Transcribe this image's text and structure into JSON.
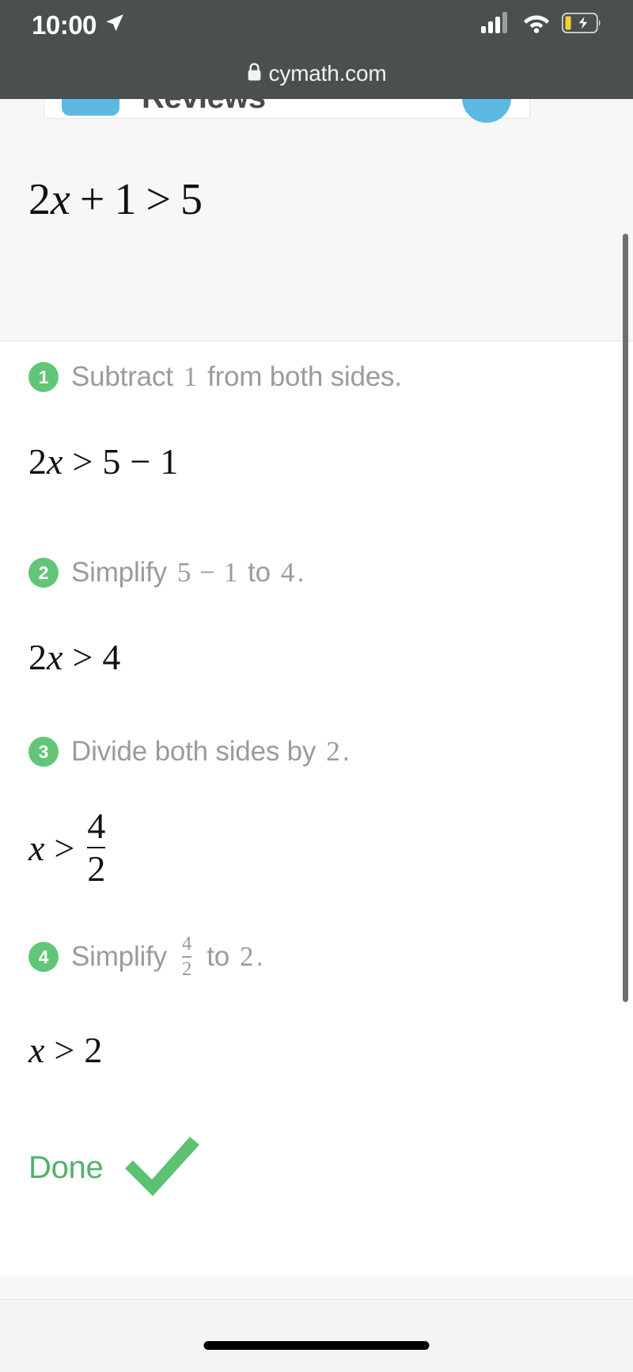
{
  "status_bar": {
    "time": "10:00",
    "location_icon": "location-arrow-icon",
    "cellular_icon": "cellular-signal-icon",
    "wifi_icon": "wifi-icon",
    "battery_icon": "battery-charging-icon",
    "background_color": "#4a4f4f"
  },
  "browser": {
    "lock_icon": "lock-icon",
    "url": "cymath.com"
  },
  "reviews_banner": {
    "title": "Reviews",
    "icon": "reviews-icon",
    "avatar": "avatar-circle",
    "accent_color": "#5bb9e2"
  },
  "problem": {
    "lhs_coefficient": "2",
    "variable": "x",
    "plus": "+",
    "constant": "1",
    "relation": ">",
    "rhs": "5",
    "full": "2x + 1 > 5"
  },
  "steps": [
    {
      "number": "1",
      "verb": "Subtract",
      "operand": "1",
      "tail": "from both sides.",
      "result_left_coeff": "2",
      "result_variable": "x",
      "result_relation": ">",
      "result_a": "5",
      "result_op": "−",
      "result_b": "1",
      "result_full": "2x > 5 − 1"
    },
    {
      "number": "2",
      "verb": "Simplify",
      "expr_a": "5",
      "expr_op": "−",
      "expr_b": "1",
      "to": "to",
      "expr_result": "4",
      "period": ".",
      "result_left_coeff": "2",
      "result_variable": "x",
      "result_relation": ">",
      "result_value": "4",
      "result_full": "2x > 4"
    },
    {
      "number": "3",
      "verb": "Divide both sides by",
      "operand": "2",
      "tail": ".",
      "result_variable": "x",
      "result_relation": ">",
      "frac_numerator": "4",
      "frac_denominator": "2",
      "result_full": "x > 4/2"
    },
    {
      "number": "4",
      "verb": "Simplify",
      "frac_numerator": "4",
      "frac_denominator": "2",
      "to": "to",
      "expr_result": "2",
      "period": ".",
      "result_variable": "x",
      "result_relation": ">",
      "result_value": "2",
      "result_full": "x > 2"
    }
  ],
  "done": {
    "label": "Done",
    "check_icon": "checkmark-icon",
    "color": "#52b26a"
  },
  "colors": {
    "badge_green": "#63c578",
    "step_text_gray": "#9b9b9b",
    "chrome_gray": "#4a4f4f",
    "page_bg": "#f7f7f7"
  },
  "scrollbar": {
    "name": "vertical-scrollbar"
  },
  "home_indicator": {
    "name": "home-indicator"
  }
}
